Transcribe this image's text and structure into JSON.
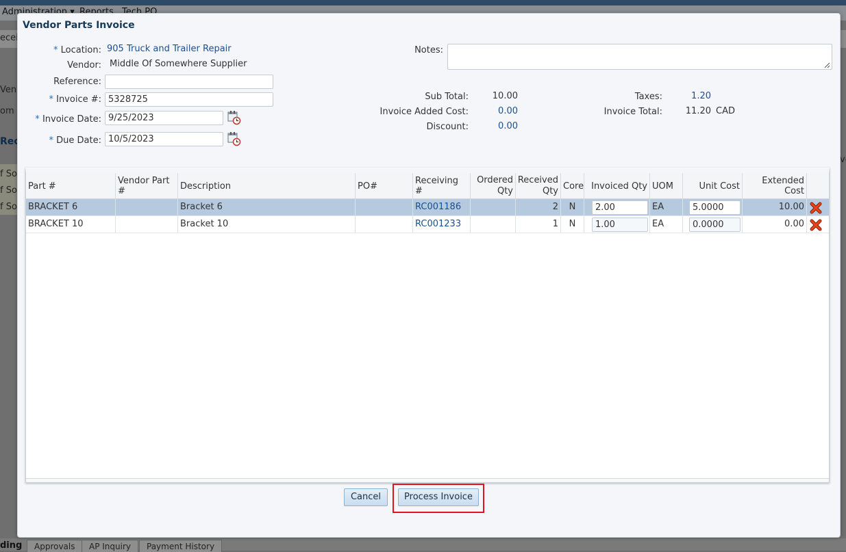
{
  "background": {
    "menu": [
      "Administration ▾",
      "Reports",
      "Tech PO"
    ],
    "fragments": [
      "eceiv",
      "Ven",
      "om D",
      "Rec",
      "f So",
      "f So",
      "f So",
      "ve",
      "ding"
    ],
    "bottom_tabs": [
      "Approvals",
      "AP Inquiry",
      "Payment History"
    ]
  },
  "dialog": {
    "title": "Vendor Parts Invoice",
    "required_marker": "*",
    "form": {
      "location_label": "Location:",
      "location_value": "905 Truck and Trailer Repair",
      "vendor_label": "Vendor:",
      "vendor_value": "Middle Of Somewhere Supplier",
      "reference_label": "Reference:",
      "reference_value": "",
      "invoice_no_label": "Invoice #:",
      "invoice_no_value": "5328725",
      "invoice_date_label": "Invoice Date:",
      "invoice_date_value": "9/25/2023",
      "due_date_label": "Due Date:",
      "due_date_value": "10/5/2023",
      "notes_label": "Notes:",
      "notes_value": ""
    },
    "totals": {
      "subtotal_label": "Sub Total:",
      "subtotal_value": "10.00",
      "added_cost_label": "Invoice Added Cost:",
      "added_cost_value": "0.00",
      "discount_label": "Discount:",
      "discount_value": "0.00",
      "taxes_label": "Taxes:",
      "taxes_value": "1.20",
      "invoice_total_label": "Invoice Total:",
      "invoice_total_value": "11.20",
      "currency": "CAD"
    },
    "grid": {
      "columns": {
        "part": "Part #",
        "vendor_part": "Vendor Part #",
        "description": "Description",
        "po": "PO#",
        "receiving": "Receiving #",
        "ordered_qty_1": "Ordered",
        "ordered_qty_2": "Qty",
        "received_qty_1": "Received",
        "received_qty_2": "Qty",
        "core": "Core",
        "invoiced_qty": "Invoiced Qty",
        "uom": "UOM",
        "unit_cost": "Unit Cost",
        "extended_cost": "Extended Cost"
      },
      "rows": [
        {
          "part": "BRACKET 6",
          "vendor_part": "",
          "description": "Bracket 6",
          "po": "",
          "receiving": "RC001186",
          "ordered_qty": "",
          "received_qty": "2",
          "core": "N",
          "invoiced_qty": "2.00",
          "uom": "EA",
          "unit_cost": "5.0000",
          "extended_cost": "10.00"
        },
        {
          "part": "BRACKET 10",
          "vendor_part": "",
          "description": "Bracket 10",
          "po": "",
          "receiving": "RC001233",
          "ordered_qty": "",
          "received_qty": "1",
          "core": "N",
          "invoiced_qty": "1.00",
          "uom": "EA",
          "unit_cost": "0.0000",
          "extended_cost": "0.00"
        }
      ]
    },
    "buttons": {
      "cancel": "Cancel",
      "process": "Process Invoice"
    }
  },
  "colors": {
    "accent": "#1c4f8e",
    "required": "#2a6db5",
    "highlight": "#e0141e",
    "delete": "#d93a14"
  },
  "icons": {
    "calendar": "calendar-clock-icon",
    "delete": "delete-x-icon",
    "resize": "resize-grip-icon"
  }
}
